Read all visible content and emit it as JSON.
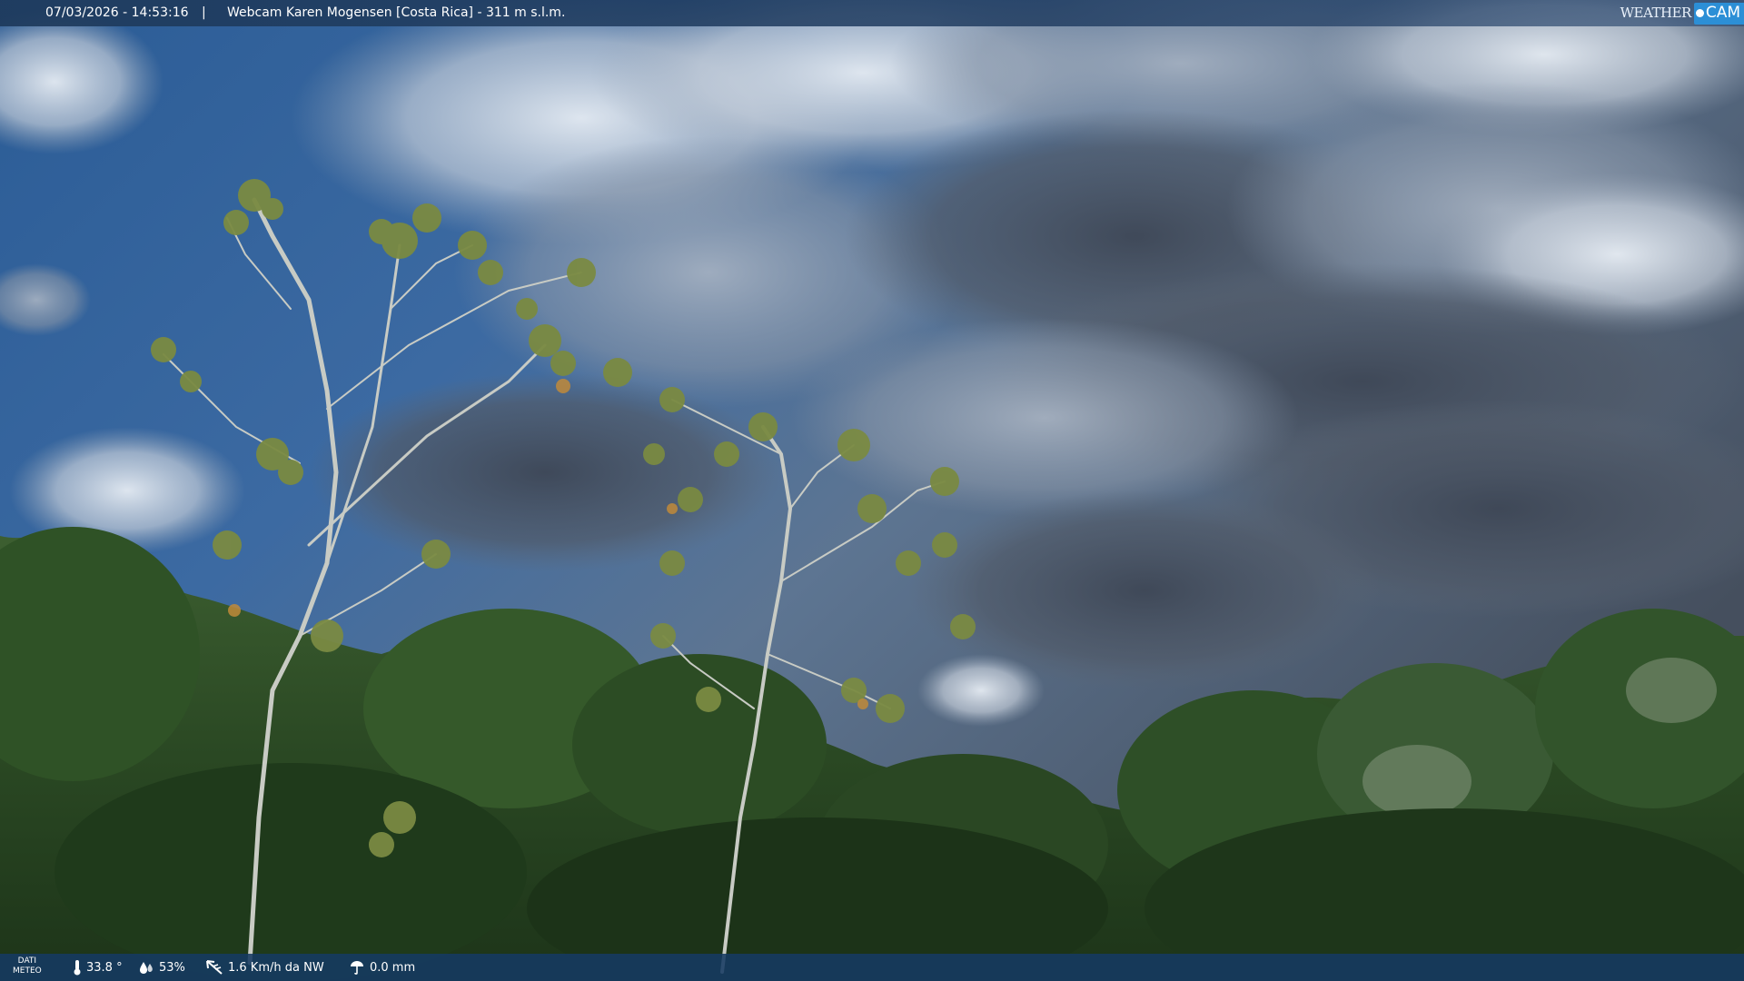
{
  "top_bar": {
    "timestamp": "07/03/2026 - 14:53:16",
    "separator": "|",
    "title": "Webcam Karen Mogensen [Costa Rica] - 311 m s.l.m."
  },
  "logo": {
    "weather": "WEATHER",
    "cam": "CAM"
  },
  "bottom_bar": {
    "label_line1": "DATI",
    "label_line2": "METEO",
    "temperature": "33.8 °",
    "humidity": "53%",
    "wind": "1.6 Km/h da NW",
    "rain": "0.0 mm"
  },
  "colors": {
    "sky_top": "#2f5f97",
    "cloud_dark": "#4a5566",
    "foliage": "#2a4a23",
    "bar": "#163a62"
  },
  "icons": [
    "thermometer-icon",
    "humidity-icon",
    "wind-icon",
    "rain-icon"
  ]
}
